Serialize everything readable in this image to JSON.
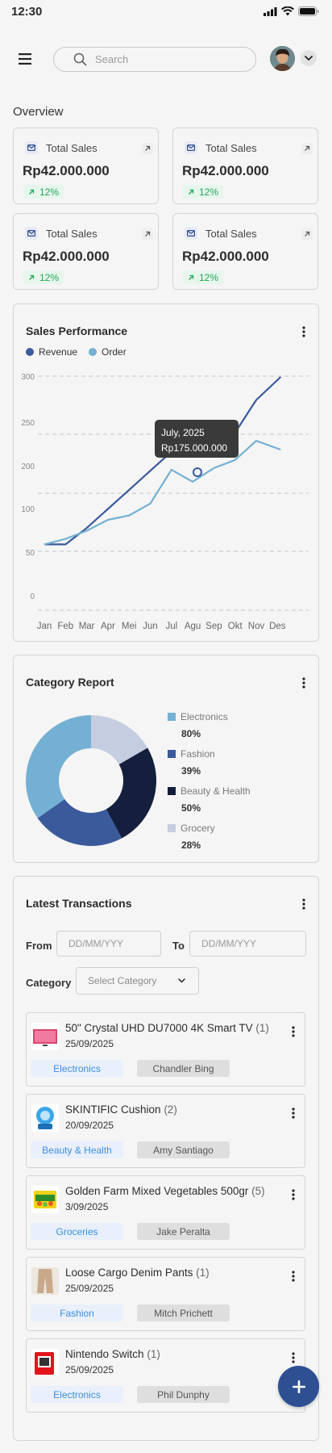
{
  "status": {
    "time": "12:30"
  },
  "search": {
    "placeholder": "Search",
    "value": ""
  },
  "overview": {
    "title": "Overview",
    "cards": [
      {
        "label": "Total Sales",
        "value": "Rp42.000.000",
        "change": "12%"
      },
      {
        "label": "Total Sales",
        "value": "Rp42.000.000",
        "change": "12%"
      },
      {
        "label": "Total Sales",
        "value": "Rp42.000.000",
        "change": "12%"
      },
      {
        "label": "Total Sales",
        "value": "Rp42.000.000",
        "change": "12%"
      }
    ]
  },
  "colors": {
    "primary": "#2f4f93",
    "revenue": "#3a5a9b",
    "order": "#74b0d3",
    "positive": "#22a55b",
    "tooltip": "#3a3a3a"
  },
  "sales": {
    "title": "Sales Performance",
    "legend": {
      "revenue": "Revenue",
      "order": "Order"
    },
    "tooltip": {
      "date": "July, 2025",
      "value": "Rp175.000.000"
    }
  },
  "chart_data": {
    "type": "line",
    "title": "Sales Performance",
    "categories": [
      "Jan",
      "Feb",
      "Mar",
      "Apr",
      "Mei",
      "Jun",
      "Jul",
      "Agu",
      "Sep",
      "Okt",
      "Nov",
      "Des"
    ],
    "yticks": [
      "300",
      "250",
      "200",
      "100",
      "50",
      "0"
    ],
    "series": [
      {
        "name": "Revenue",
        "values": [
          35,
          35,
          65,
          100,
          135,
          170,
          205,
          240,
          240,
          240,
          300,
          null
        ]
      },
      {
        "name": "Order",
        "values": [
          35,
          45,
          60,
          80,
          88,
          110,
          172,
          150,
          175,
          190,
          225,
          null
        ]
      }
    ],
    "grid": true,
    "legend_position": "top-left"
  },
  "category": {
    "title": "Category Report",
    "items": [
      {
        "name": "Electronics",
        "pct": "80%",
        "color": "#74b0d3"
      },
      {
        "name": "Fashion",
        "pct": "39%",
        "color": "#3a5a9b"
      },
      {
        "name": "Beauty & Health",
        "pct": "50%",
        "color": "#141f3d"
      },
      {
        "name": "Grocery",
        "pct": "28%",
        "color": "#c5cde0"
      }
    ]
  },
  "transactions": {
    "title": "Latest Transactions",
    "from_label": "From",
    "to_label": "To",
    "date_placeholder": "DD/MM/YYY",
    "category_label": "Category",
    "category_placeholder": "Select Category",
    "items": [
      {
        "name": "50\" Crystal UHD DU7000 4K Smart TV",
        "qty": "(1)",
        "date": "25/09/2025",
        "category": "Electronics",
        "user": "Chandler Bing"
      },
      {
        "name": "SKINTIFIC Cushion",
        "qty": "(2)",
        "date": "20/09/2025",
        "category": "Beauty & Health",
        "user": "Amy Santiago"
      },
      {
        "name": "Golden Farm Mixed Vegetables 500gr",
        "qty": "(5)",
        "date": "3/09/2025",
        "category": "Groceries",
        "user": "Jake Peralta"
      },
      {
        "name": "Loose Cargo Denim Pants",
        "qty": "(1)",
        "date": "25/09/2025",
        "category": "Fashion",
        "user": "Mitch Prichett"
      },
      {
        "name": "Nintendo Switch",
        "qty": "(1)",
        "date": "25/09/2025",
        "category": "Electronics",
        "user": "Phil Dunphy"
      }
    ]
  }
}
